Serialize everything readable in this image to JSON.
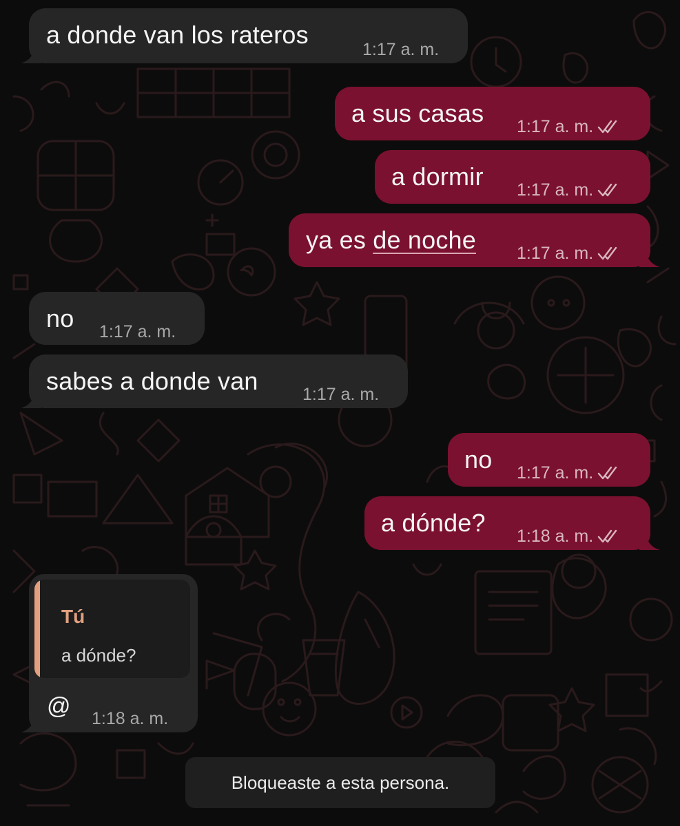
{
  "messages": [
    {
      "id": "m1",
      "direction": "in",
      "text": "a donde van los rateros",
      "time": "1:17 a. m."
    },
    {
      "id": "m2",
      "direction": "out",
      "text": "a sus casas",
      "time": "1:17 a. m.",
      "status": "read"
    },
    {
      "id": "m3",
      "direction": "out",
      "text": "a dormir",
      "time": "1:17 a. m.",
      "status": "read"
    },
    {
      "id": "m4",
      "direction": "out",
      "text_prefix": "ya es ",
      "text_link": "de noche",
      "time": "1:17 a. m.",
      "status": "read"
    },
    {
      "id": "m5",
      "direction": "in",
      "text": "no",
      "time": "1:17 a. m."
    },
    {
      "id": "m6",
      "direction": "in",
      "text": "sabes a donde van",
      "time": "1:17 a. m."
    },
    {
      "id": "m7",
      "direction": "out",
      "text": "no",
      "time": "1:17 a. m.",
      "status": "read"
    },
    {
      "id": "m8",
      "direction": "out",
      "text": "a dónde?",
      "time": "1:18 a. m.",
      "status": "read"
    },
    {
      "id": "m9",
      "direction": "in",
      "text": "@",
      "time": "1:18 a. m.",
      "reply": {
        "author": "Tú",
        "text": "a dónde?"
      }
    }
  ],
  "system_message": "Bloqueaste a esta persona.",
  "colors": {
    "incoming_bubble": "#262626",
    "outgoing_bubble": "#7b1130",
    "reply_accent": "#e2a07f",
    "background": "#0d0c0c"
  },
  "icons": {
    "read_status": "double-check-icon"
  }
}
